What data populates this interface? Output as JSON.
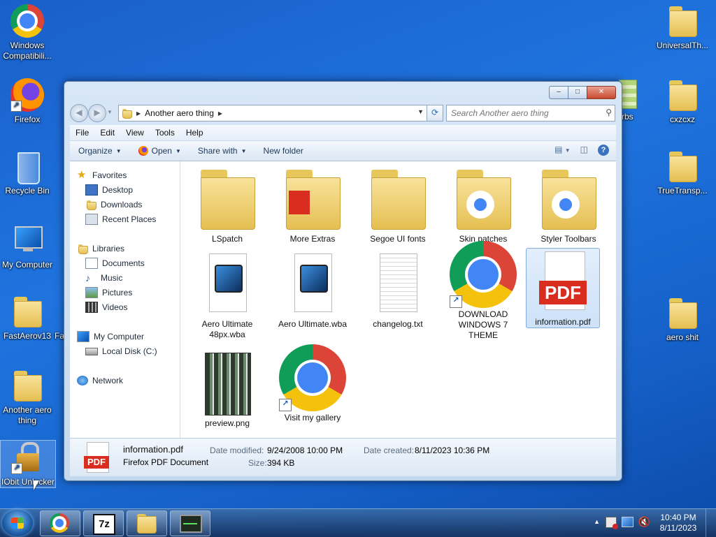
{
  "desktop": {
    "icons": [
      {
        "label": "Windows Compatibili...",
        "icon": "chrome-icon"
      },
      {
        "label": "Firefox",
        "icon": "firefox-icon"
      },
      {
        "label": "Recycle Bin",
        "icon": "recycle-bin-icon"
      },
      {
        "label": "My Computer",
        "icon": "computer-icon"
      },
      {
        "label": "FastAerov13",
        "icon": "folder-icon"
      },
      {
        "label": "Another aero thing",
        "icon": "folder-icon"
      },
      {
        "label": "IObit Unlocker",
        "icon": "unlocker-icon"
      },
      {
        "label": "UniversalTh...",
        "icon": "folder-icon"
      },
      {
        "label": "cxzcxz",
        "icon": "folder-icon"
      },
      {
        "label": "TrueTransp...",
        "icon": "folder-icon"
      },
      {
        "label": "aero shit",
        "icon": "folder-icon"
      },
      {
        "label": "orbs",
        "icon": "folder-icon"
      },
      {
        "label": "Fa",
        "icon": "folder-icon"
      }
    ]
  },
  "explorer": {
    "caption": {
      "minimize": "–",
      "maximize": "□",
      "close": "✕"
    },
    "nav": {
      "back": "◀",
      "forward": "▶"
    },
    "address": {
      "path": "Another aero thing"
    },
    "search": {
      "placeholder": "Search Another aero thing"
    },
    "menu": [
      "File",
      "Edit",
      "View",
      "Tools",
      "Help"
    ],
    "toolbar": {
      "organize": "Organize",
      "open": "Open",
      "share_with": "Share with",
      "new_folder": "New folder",
      "help": "?"
    },
    "nav_pane": [
      {
        "label": "Favorites",
        "icon": "star-icon"
      },
      {
        "label": "Desktop",
        "icon": "desktop-icon"
      },
      {
        "label": "Downloads",
        "icon": "downloads-icon"
      },
      {
        "label": "Recent Places",
        "icon": "recent-places-icon"
      },
      {
        "label": "Libraries",
        "icon": "libraries-icon"
      },
      {
        "label": "Documents",
        "icon": "documents-icon"
      },
      {
        "label": "Music",
        "icon": "music-icon"
      },
      {
        "label": "Pictures",
        "icon": "pictures-icon"
      },
      {
        "label": "Videos",
        "icon": "videos-icon"
      },
      {
        "label": "My Computer",
        "icon": "computer-icon"
      },
      {
        "label": "Local Disk (C:)",
        "icon": "disk-icon"
      },
      {
        "label": "Network",
        "icon": "network-icon"
      }
    ],
    "items": [
      {
        "label": "LSpatch",
        "icon": "folder-icon"
      },
      {
        "label": "More Extras",
        "icon": "folder-icon"
      },
      {
        "label": "Segoe UI fonts",
        "icon": "folder-icon"
      },
      {
        "label": "Skin patches",
        "icon": "folder-icon"
      },
      {
        "label": "Styler Toolbars",
        "icon": "folder-icon"
      },
      {
        "label": "Aero Ultimate 48px.wba",
        "icon": "wba-file-icon"
      },
      {
        "label": "Aero Ultimate.wba",
        "icon": "wba-file-icon"
      },
      {
        "label": "changelog.txt",
        "icon": "text-file-icon"
      },
      {
        "label": "DOWNLOAD WINDOWS 7 THEME",
        "icon": "chrome-shortcut-icon"
      },
      {
        "label": "information.pdf",
        "icon": "pdf-file-icon",
        "pdf_text": "PDF"
      },
      {
        "label": "preview.png",
        "icon": "image-file-icon"
      },
      {
        "label": "Visit my gallery",
        "icon": "chrome-shortcut-icon"
      }
    ],
    "details": {
      "name": "information.pdf",
      "type": "Firefox PDF Document",
      "pdf_text": "PDF",
      "modified_label": "Date modified:",
      "modified": "9/24/2008 10:00 PM",
      "size_label": "Size:",
      "size": "394 KB",
      "created_label": "Date created:",
      "created": "8/11/2023 10:36 PM"
    }
  },
  "taskbar": {
    "apps": [
      {
        "name": "Chrome",
        "icon": "chrome-icon"
      },
      {
        "name": "7-Zip",
        "icon": "7zip-icon",
        "text": "7z"
      },
      {
        "name": "Windows Explorer",
        "icon": "folder-icon"
      },
      {
        "name": "System Monitor",
        "icon": "monitor-icon"
      }
    ],
    "time": "10:40 PM",
    "date": "8/11/2023"
  }
}
